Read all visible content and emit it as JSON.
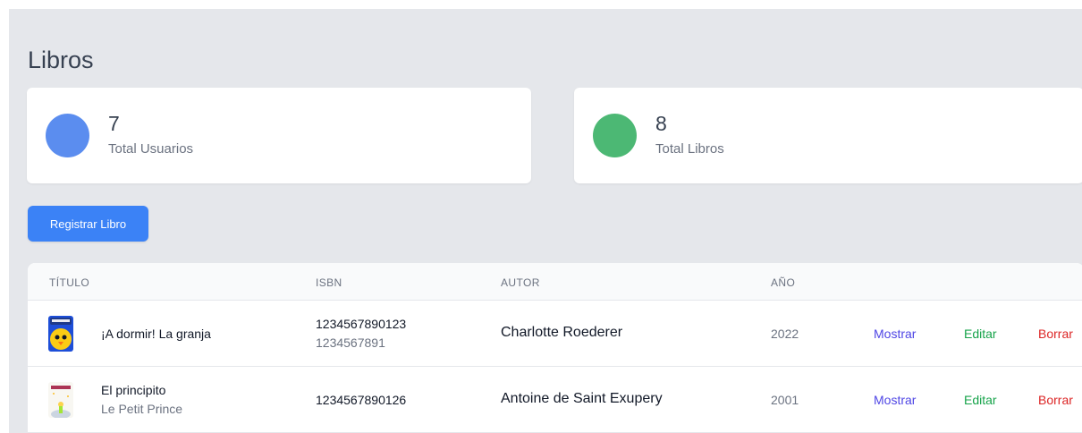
{
  "page": {
    "title": "Libros"
  },
  "stats": [
    {
      "value": "7",
      "label": "Total Usuarios",
      "color": "#5b8def"
    },
    {
      "value": "8",
      "label": "Total Libros",
      "color": "#4cb874"
    }
  ],
  "actions": {
    "register_label": "Registrar Libro"
  },
  "table": {
    "headers": {
      "title": "TÍTULO",
      "isbn": "ISBN",
      "author": "AUTOR",
      "year": "AÑO"
    },
    "rows": [
      {
        "title": "¡A dormir! La granja",
        "subtitle": "",
        "isbn": "1234567890123",
        "isbn_secondary": "1234567891",
        "author": "Charlotte Roederer",
        "year": "2022",
        "show": "Mostrar",
        "edit": "Editar",
        "delete": "Borrar",
        "cover_icon": "book-cover-chick"
      },
      {
        "title": "El principito",
        "subtitle": "Le Petit Prince",
        "isbn": "1234567890126",
        "isbn_secondary": "",
        "author": "Antoine de Saint Exupery",
        "year": "2001",
        "show": "Mostrar",
        "edit": "Editar",
        "delete": "Borrar",
        "cover_icon": "book-cover-little-prince"
      }
    ]
  }
}
